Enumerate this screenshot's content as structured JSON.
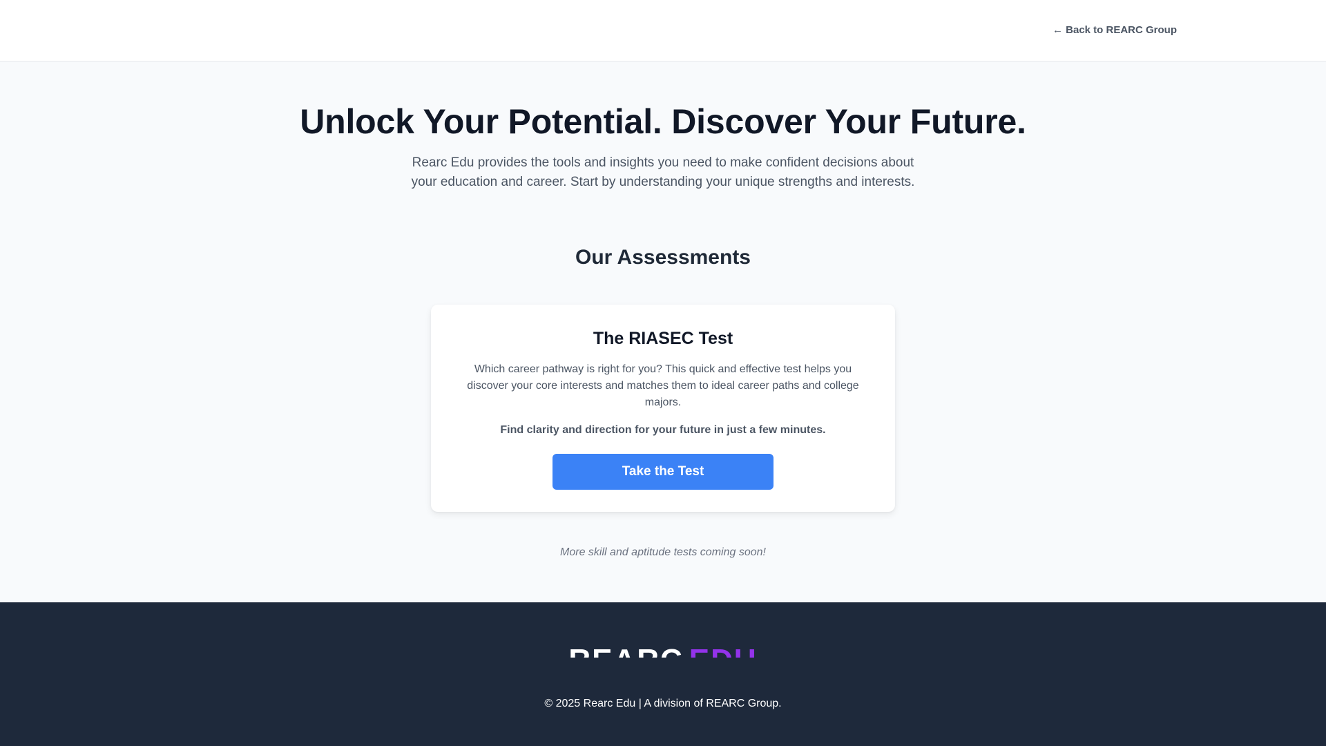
{
  "header": {
    "back_link": "← Back to REARC Group"
  },
  "hero": {
    "title": "Unlock Your Potential. Discover Your Future.",
    "subtitle": "Rearc Edu provides the tools and insights you need to make confident decisions about your education and career. Start by understanding your unique strengths and interests."
  },
  "assessments": {
    "section_title": "Our Assessments",
    "card": {
      "title": "The RIASEC Test",
      "description": "Which career pathway is right for you? This quick and effective test helps you discover your core interests and matches them to ideal career paths and college majors.",
      "tagline": "Find clarity and direction for your future in just a few minutes.",
      "button_label": "Take the Test"
    },
    "coming_soon": "More skill and aptitude tests coming soon!"
  },
  "footer": {
    "logo_primary": "REARC",
    "logo_secondary": "EDU",
    "copyright": "© 2025 Rearc Edu | A division of REARC Group."
  },
  "colors": {
    "accent": "#3b82f6",
    "logo_purple": "#9333ea",
    "footer_bg": "#1e293b"
  }
}
